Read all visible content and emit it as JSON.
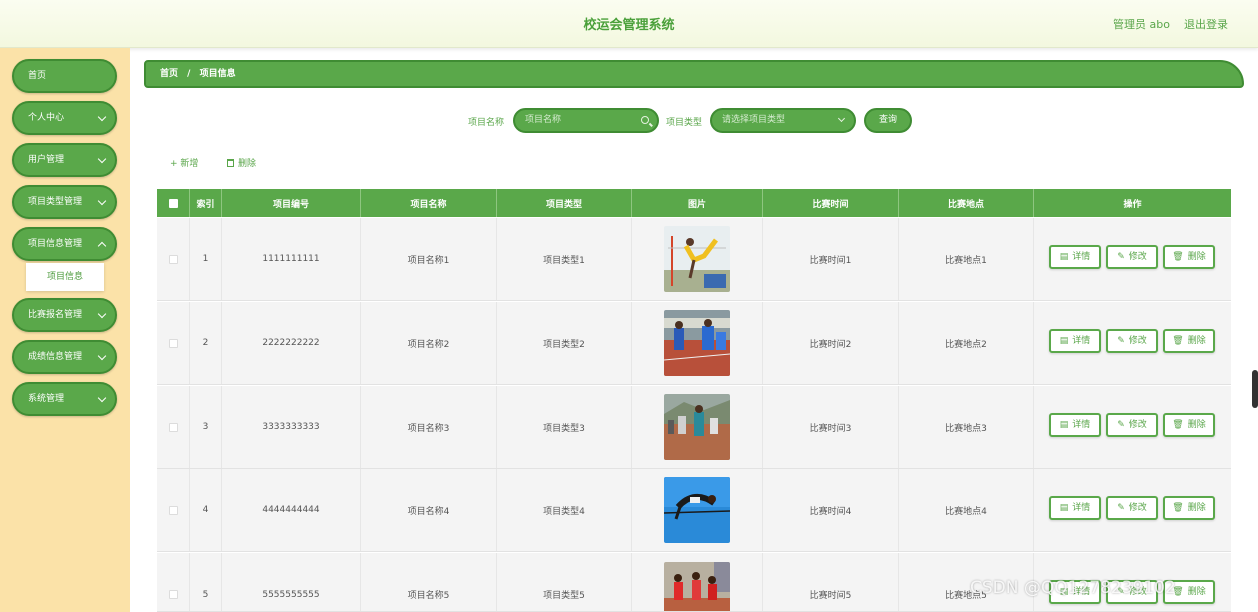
{
  "header": {
    "title": "校运会管理系统",
    "user": "管理员 abo",
    "logout": "退出登录"
  },
  "sidebar": {
    "items": [
      {
        "label": "首页",
        "has_children": false
      },
      {
        "label": "个人中心",
        "has_children": true
      },
      {
        "label": "用户管理",
        "has_children": true
      },
      {
        "label": "项目类型管理",
        "has_children": true
      },
      {
        "label": "项目信息管理",
        "has_children": true
      },
      {
        "label": "比赛报名管理",
        "has_children": true
      },
      {
        "label": "成绩信息管理",
        "has_children": true
      },
      {
        "label": "系统管理",
        "has_children": true
      }
    ],
    "active_sub": "项目信息"
  },
  "breadcrumb": {
    "home": "首页",
    "separator": "/",
    "current": "项目信息"
  },
  "search": {
    "name_label": "项目名称",
    "name_placeholder": "项目名称",
    "type_label": "项目类型",
    "type_placeholder": "请选择项目类型",
    "query_label": "查询"
  },
  "actions": {
    "add_label": "+ 新增",
    "delete_label": "删除"
  },
  "table": {
    "headers": [
      "索引",
      "项目编号",
      "项目名称",
      "项目类型",
      "图片",
      "比赛时间",
      "比赛地点",
      "操作"
    ],
    "rows": [
      {
        "index": "1",
        "code": "1111111111",
        "name": "项目名称1",
        "type": "项目类型1",
        "time": "比赛时间1",
        "place": "比赛地点1"
      },
      {
        "index": "2",
        "code": "2222222222",
        "name": "项目名称2",
        "type": "项目类型2",
        "time": "比赛时间2",
        "place": "比赛地点2"
      },
      {
        "index": "3",
        "code": "3333333333",
        "name": "项目名称3",
        "type": "项目类型3",
        "time": "比赛时间3",
        "place": "比赛地点3"
      },
      {
        "index": "4",
        "code": "4444444444",
        "name": "项目名称4",
        "type": "项目类型4",
        "time": "比赛时间4",
        "place": "比赛地点4"
      },
      {
        "index": "5",
        "code": "5555555555",
        "name": "项目名称5",
        "type": "项目类型5",
        "time": "比赛时间5",
        "place": "比赛地点5"
      }
    ],
    "op_labels": {
      "detail": "详情",
      "edit": "修改",
      "delete": "删除"
    }
  },
  "watermark": "CSDN @QQ1278239102",
  "colors": {
    "primary": "#5aa84a",
    "primary_dark": "#3f8c33",
    "sidebar_bg": "#fbe2a8",
    "header_bg": "#f3f8df"
  }
}
